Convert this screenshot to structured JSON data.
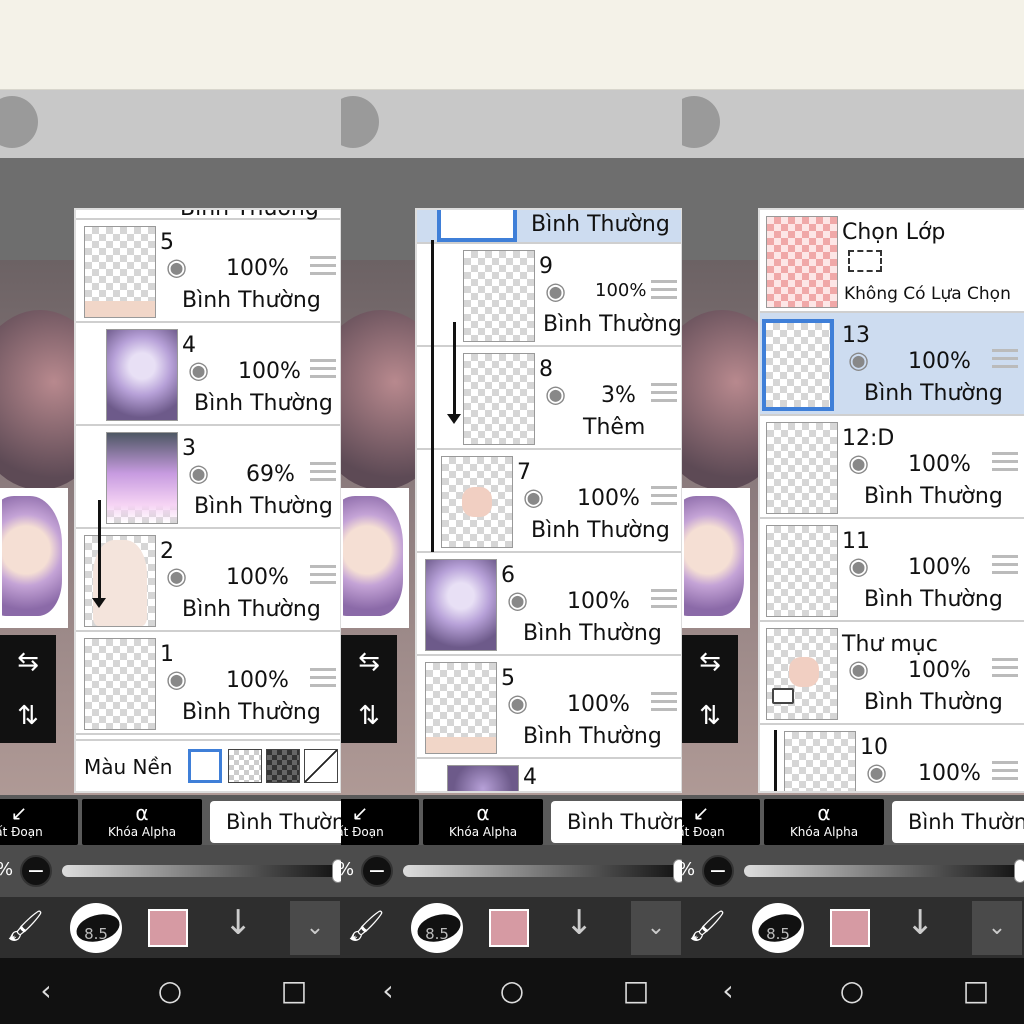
{
  "common": {
    "merge_label": "ất Đoạn",
    "alpha_label": "Khóa Alpha",
    "blend_mode": "Bình Thườn",
    "opacity_pct": "%",
    "minus": "−",
    "brush_size": "8.5",
    "brush_color": "#d69aa3",
    "accent": "#3f7fd8",
    "icons": {
      "flip_h": "⇆",
      "flip_v": "⇅",
      "merge": "↙",
      "alpha": "α",
      "brush": "🖌",
      "down": "↓",
      "expand": "⌄",
      "eye": "◉",
      "back": "‹",
      "home": "○",
      "recent": "□"
    }
  },
  "panel1": {
    "partial_top": "Bình Thường",
    "layers": [
      {
        "num": "5",
        "opacity": "100%",
        "blend": "Bình Thường"
      },
      {
        "num": "4",
        "opacity": "100%",
        "blend": "Bình Thường"
      },
      {
        "num": "3",
        "opacity": "69%",
        "blend": "Bình Thường"
      },
      {
        "num": "2",
        "opacity": "100%",
        "blend": "Bình Thường"
      },
      {
        "num": "1",
        "opacity": "100%",
        "blend": "Bình Thường"
      }
    ],
    "background_label": "Màu Nền"
  },
  "panel2": {
    "partial_top": "Bình Thường",
    "layers": [
      {
        "num": "9",
        "opacity": "100%",
        "blend": "Bình Thường"
      },
      {
        "num": "8",
        "opacity": "3%",
        "blend": "Thêm"
      },
      {
        "num": "7",
        "opacity": "100%",
        "blend": "Bình Thường"
      },
      {
        "num": "6",
        "opacity": "100%",
        "blend": "Bình Thường"
      },
      {
        "num": "5",
        "opacity": "100%",
        "blend": "Bình Thường"
      }
    ],
    "partial_bottom": "4"
  },
  "panel3": {
    "selection_title": "Chọn Lớp",
    "selection_status": "Không Có Lựa Chọn",
    "layers": [
      {
        "num": "13",
        "opacity": "100%",
        "blend": "Bình Thường"
      },
      {
        "num": "12:D",
        "opacity": "100%",
        "blend": "Bình Thường"
      },
      {
        "num": "11",
        "opacity": "100%",
        "blend": "Bình Thường"
      },
      {
        "num": "Thư mục",
        "opacity": "100%",
        "blend": "Bình Thường"
      },
      {
        "num": "10",
        "opacity": "100%",
        "blend": ""
      }
    ]
  }
}
